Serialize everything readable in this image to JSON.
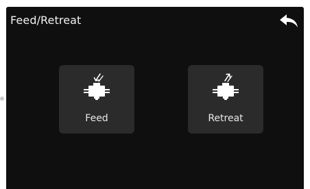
{
  "header": {
    "title": "Feed/Retreat",
    "back_icon": "back-arrow-icon"
  },
  "actions": [
    {
      "label": "Feed",
      "icon": "feed-filament-icon"
    },
    {
      "label": "Retreat",
      "icon": "retreat-filament-icon"
    }
  ],
  "colors": {
    "screen_background": "#0f0f0f",
    "tile_background": "#2b2b2b",
    "text": "#f2f2f2"
  }
}
